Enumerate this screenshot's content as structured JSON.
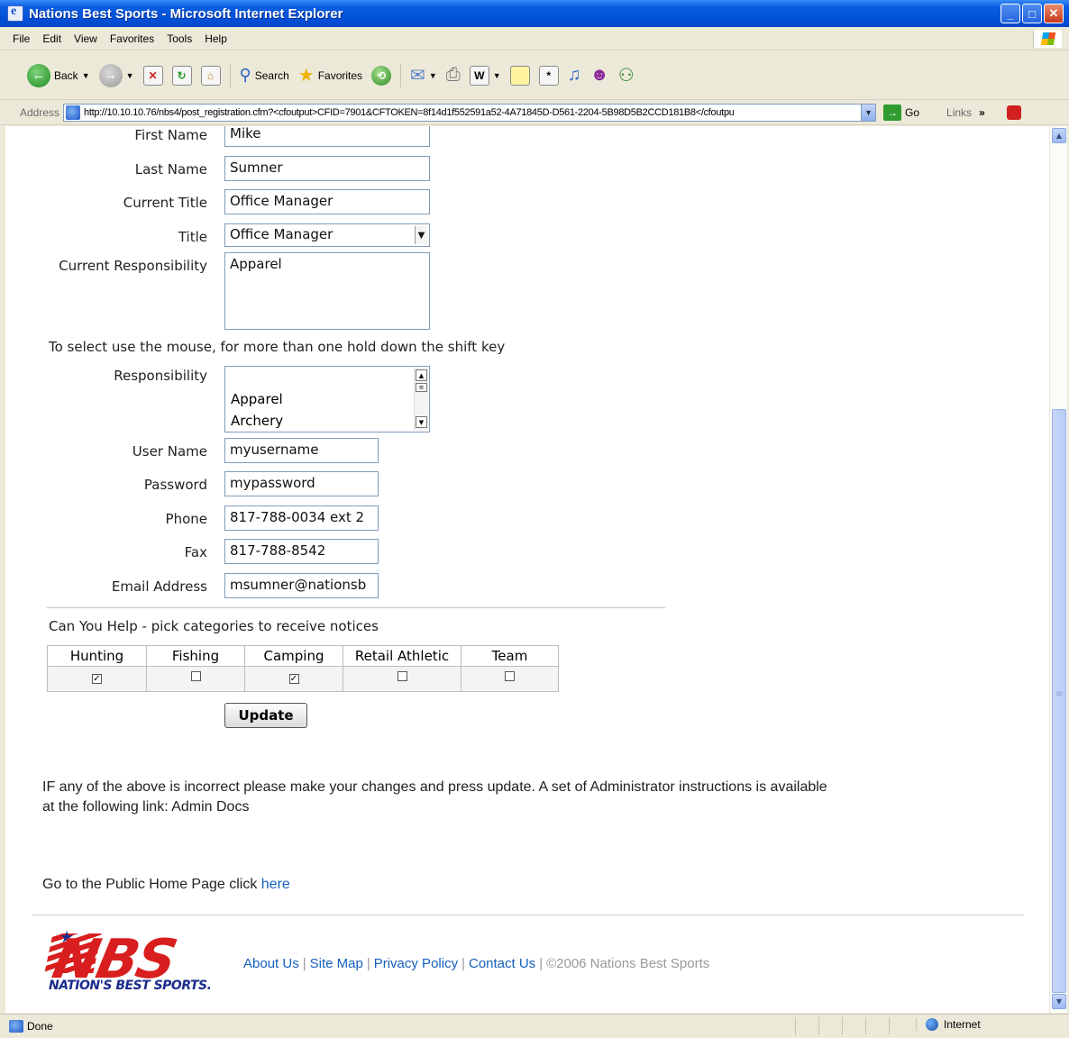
{
  "window": {
    "title": "Nations Best Sports - Microsoft Internet Explorer"
  },
  "menu": [
    "File",
    "Edit",
    "View",
    "Favorites",
    "Tools",
    "Help"
  ],
  "toolbar": {
    "back": "Back",
    "search": "Search",
    "favorites": "Favorites"
  },
  "address": {
    "label": "Address",
    "url": "http://10.10.10.76/nbs4/post_registration.cfm?<cfoutput>CFID=7901&CFTOKEN=8f14d1f552591a52-4A71845D-D561-2204-5B98D5B2CCD181B8</cfoutpu",
    "go": "Go",
    "links": "Links"
  },
  "form": {
    "first_name": {
      "label": "First Name",
      "value": "Mike"
    },
    "last_name": {
      "label": "Last Name",
      "value": "Sumner"
    },
    "current_title": {
      "label": "Current Title",
      "value": "Office Manager"
    },
    "title": {
      "label": "Title",
      "value": "Office Manager"
    },
    "current_responsibility": {
      "label": "Current Responsibility",
      "value": "Apparel"
    },
    "select_note": "To select use the mouse, for more than one hold down the shift key",
    "responsibility": {
      "label": "Responsibility",
      "options": [
        "Apparel",
        "Archery"
      ]
    },
    "username": {
      "label": "User Name",
      "value": "myusername"
    },
    "password": {
      "label": "Password",
      "value": "mypassword"
    },
    "phone": {
      "label": "Phone",
      "value": "817-788-0034 ext 2"
    },
    "fax": {
      "label": "Fax",
      "value": "817-788-8542"
    },
    "email": {
      "label": "Email Address",
      "value": "msumner@nationsb"
    },
    "help_note": "Can You Help - pick categories to receive notices",
    "categories": [
      {
        "name": "Hunting",
        "checked": true
      },
      {
        "name": "Fishing",
        "checked": false
      },
      {
        "name": "Camping",
        "checked": true
      },
      {
        "name": "Retail Athletic",
        "checked": false
      },
      {
        "name": "Team",
        "checked": false
      }
    ],
    "update": "Update"
  },
  "content": {
    "para1_line1": "IF any of the above is incorrect please make your changes and press update. A set of Administrator instructions is available",
    "para1_line2": "at the following link: Admin Docs",
    "para2_text": "Go to the Public Home Page click ",
    "para2_link": "here"
  },
  "footer": {
    "logo_text": "NBS",
    "logo_tagline": "NATION'S BEST SPORTS.",
    "links": [
      "About Us",
      "Site Map",
      "Privacy Policy",
      "Contact Us"
    ],
    "copyright": "©2006 Nations Best Sports"
  },
  "status": {
    "left": "Done",
    "zone": "Internet"
  }
}
